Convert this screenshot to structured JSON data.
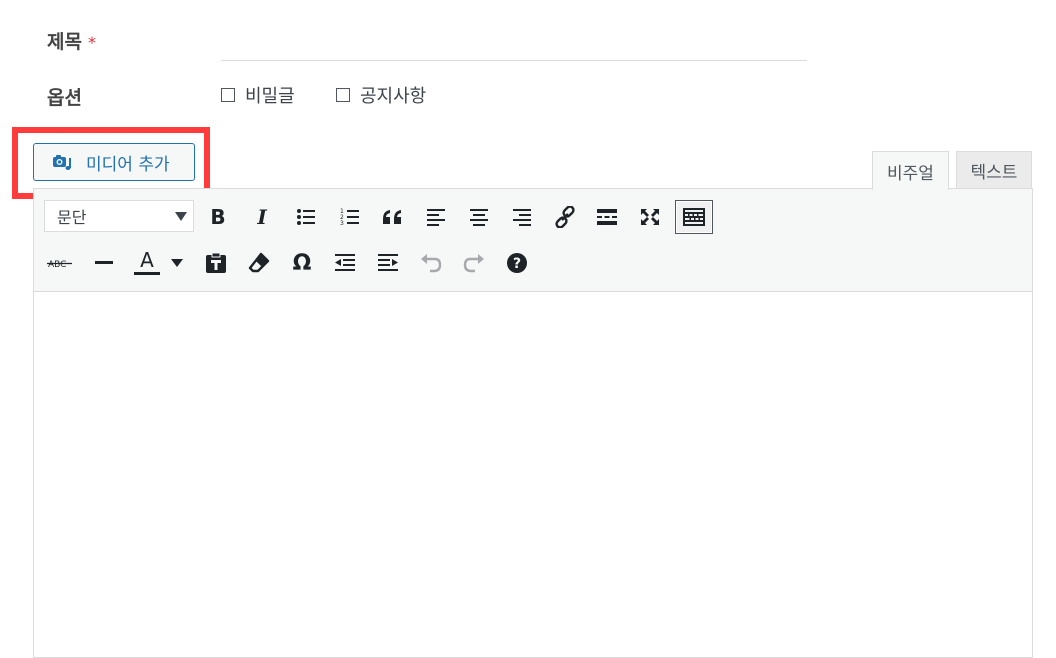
{
  "form": {
    "title_label": "제목",
    "required_mark": "*",
    "title_value": "",
    "options_label": "옵션",
    "options": [
      {
        "label": "비밀글",
        "checked": false
      },
      {
        "label": "공지사항",
        "checked": false
      }
    ]
  },
  "media_button": {
    "label": "미디어 추가",
    "icon": "media-camera-music-icon",
    "color": "#2271b1"
  },
  "editor_tabs": [
    {
      "label": "비주얼",
      "active": true
    },
    {
      "label": "텍스트",
      "active": false
    }
  ],
  "toolbar": {
    "format_select": {
      "value": "문단"
    },
    "row1": [
      "bold-icon",
      "italic-icon",
      "bulleted-list-icon",
      "numbered-list-icon",
      "blockquote-icon",
      "align-left-icon",
      "align-center-icon",
      "align-right-icon",
      "link-icon",
      "read-more-icon",
      "fullscreen-icon",
      "toolbar-toggle-icon"
    ],
    "row2": [
      "strikethrough-icon",
      "horizontal-line-icon",
      "text-color-icon",
      "paste-as-text-icon",
      "clear-formatting-icon",
      "special-character-icon",
      "outdent-icon",
      "indent-icon",
      "undo-icon",
      "redo-icon",
      "help-icon"
    ],
    "strikethrough_text": "ABC",
    "text_color_letter": "A",
    "bold_letter": "B",
    "italic_letter": "I",
    "omega": "Ω",
    "help_glyph": "?"
  },
  "colors": {
    "highlight": "#ff3b3b",
    "accent": "#2271b1",
    "required": "#d63638"
  }
}
